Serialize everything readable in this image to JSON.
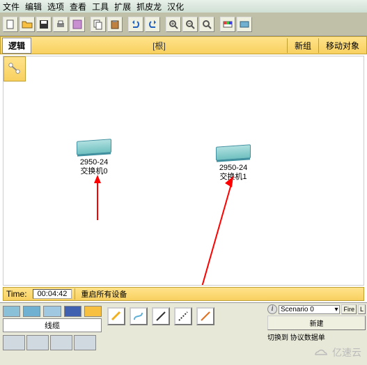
{
  "menu": {
    "file": "文件",
    "edit": "编辑",
    "options": "选项",
    "view": "查看",
    "tools": "工具",
    "extensions": "扩展",
    "dragon": "抓皮龙",
    "chinese": "汉化"
  },
  "logical_bar": {
    "tab": "逻辑",
    "root": "[根]",
    "new_group": "新组",
    "move_obj": "移动对象"
  },
  "devices": {
    "switch0": {
      "model": "2950-24",
      "name": "交换机0"
    },
    "switch1": {
      "model": "2950-24",
      "name": "交换机1"
    }
  },
  "status": {
    "time_label": "Time:",
    "time_value": "00:04:42",
    "reset": "重启所有设备"
  },
  "bottom": {
    "category_label": "线缆",
    "scenario_label": "Scenario 0",
    "new_btn": "新建",
    "toggle": "切换到 协议数据单",
    "fire": "Fire",
    "l": "L"
  },
  "watermark": "亿速云"
}
